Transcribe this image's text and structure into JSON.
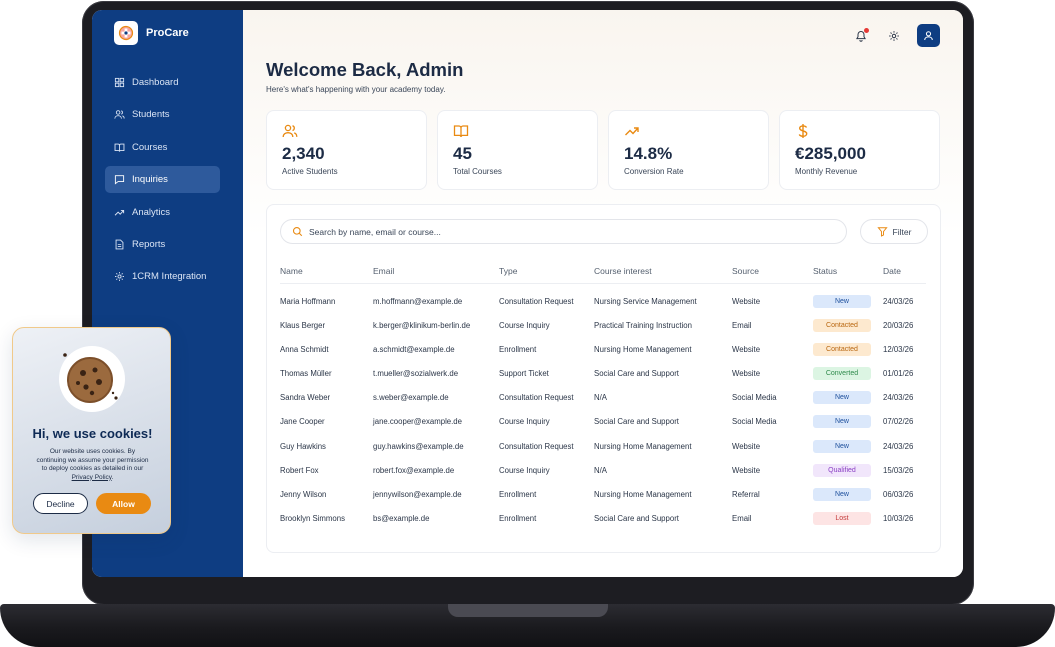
{
  "app": {
    "name": "ProCare"
  },
  "sidebar": {
    "items": [
      {
        "label": "Dashboard",
        "icon": "dashboard-icon",
        "active": false
      },
      {
        "label": "Students",
        "icon": "users-icon",
        "active": false
      },
      {
        "label": "Courses",
        "icon": "book-icon",
        "active": false
      },
      {
        "label": "Inquiries",
        "icon": "message-icon",
        "active": true
      },
      {
        "label": "Analytics",
        "icon": "trending-icon",
        "active": false
      },
      {
        "label": "Reports",
        "icon": "document-icon",
        "active": false
      },
      {
        "label": "1CRM Integration",
        "icon": "gear-icon",
        "active": false
      }
    ]
  },
  "header": {
    "title": "Welcome Back, Admin",
    "subtitle": "Here's what's happening with your academy today."
  },
  "stats": [
    {
      "value": "2,340",
      "label": "Active Students",
      "icon": "users-icon"
    },
    {
      "value": "45",
      "label": "Total Courses",
      "icon": "book-icon"
    },
    {
      "value": "14.8%",
      "label": "Conversion Rate",
      "icon": "trending-up-icon"
    },
    {
      "value": "€285,000",
      "label": "Monthly Revenue",
      "icon": "dollar-icon"
    }
  ],
  "search": {
    "placeholder": "Search by name, email or course..."
  },
  "filter": {
    "label": "Filter"
  },
  "table": {
    "columns": [
      "Name",
      "Email",
      "Type",
      "Course interest",
      "Source",
      "Status",
      "Date"
    ],
    "rows": [
      {
        "name": "Maria Hoffmann",
        "email": "m.hoffmann@example.de",
        "type": "Consultation Request",
        "course": "Nursing Service Management",
        "source": "Website",
        "status": "New",
        "date": "24/03/26"
      },
      {
        "name": "Klaus Berger",
        "email": "k.berger@klinikum-berlin.de",
        "type": "Course Inquiry",
        "course": "Practical Training Instruction",
        "source": "Email",
        "status": "Contacted",
        "date": "20/03/26"
      },
      {
        "name": "Anna Schmidt",
        "email": "a.schmidt@example.de",
        "type": "Enrollment",
        "course": "Nursing Home Management",
        "source": "Website",
        "status": "Contacted",
        "date": "12/03/26"
      },
      {
        "name": "Thomas Müller",
        "email": "t.mueller@sozialwerk.de",
        "type": "Support Ticket",
        "course": "Social Care and Support",
        "source": "Website",
        "status": "Converted",
        "date": "01/01/26"
      },
      {
        "name": "Sandra Weber",
        "email": "s.weber@example.de",
        "type": "Consultation Request",
        "course": "N/A",
        "source": "Social Media",
        "status": "New",
        "date": "24/03/26"
      },
      {
        "name": "Jane Cooper",
        "email": "jane.cooper@example.de",
        "type": "Course Inquiry",
        "course": "Social Care and Support",
        "source": "Social Media",
        "status": "New",
        "date": "07/02/26"
      },
      {
        "name": "Guy Hawkins",
        "email": "guy.hawkins@example.de",
        "type": "Consultation Request",
        "course": "Nursing Home Management",
        "source": "Website",
        "status": "New",
        "date": "24/03/26"
      },
      {
        "name": "Robert Fox",
        "email": "robert.fox@example.de",
        "type": "Course Inquiry",
        "course": "N/A",
        "source": "Website",
        "status": "Qualified",
        "date": "15/03/26"
      },
      {
        "name": "Jenny Wilson",
        "email": "jennywilson@example.de",
        "type": "Enrollment",
        "course": "Nursing Home Management",
        "source": "Referral",
        "status": "New",
        "date": "06/03/26"
      },
      {
        "name": "Brooklyn Simmons",
        "email": "bs@example.de",
        "type": "Enrollment",
        "course": "Social Care and Support",
        "source": "Email",
        "status": "Lost",
        "date": "10/03/26"
      }
    ]
  },
  "status_colors": {
    "New": {
      "bg": "#dbe8fb",
      "fg": "#1d4f9c"
    },
    "Contacted": {
      "bg": "#fde9cf",
      "fg": "#b8660f"
    },
    "Converted": {
      "bg": "#dcf5e3",
      "fg": "#2e8a4b"
    },
    "Qualified": {
      "bg": "#f1e6fb",
      "fg": "#8a3fc4"
    },
    "Lost": {
      "bg": "#fde4e4",
      "fg": "#c23a3a"
    }
  },
  "colors": {
    "sidebar": "#0e3d82",
    "accent": "#e98a12"
  }
}
